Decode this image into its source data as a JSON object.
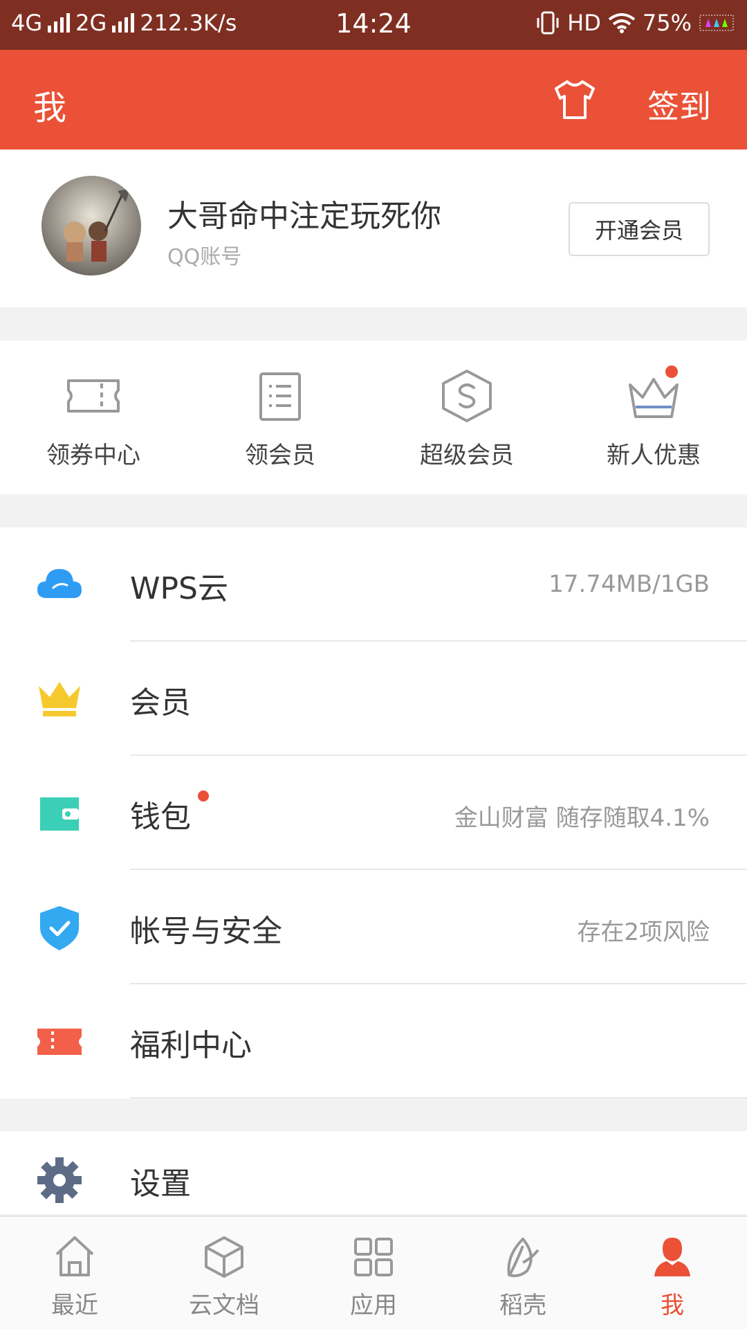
{
  "status_bar": {
    "net1": "4G",
    "net2": "2G",
    "speed": "212.3K/s",
    "time": "14:24",
    "hd": "HD",
    "battery": "75%"
  },
  "header": {
    "title": "我",
    "checkin_label": "签到",
    "shirt_icon": "tshirt-icon"
  },
  "profile": {
    "name": "大哥命中注定玩死你",
    "account_type": "QQ账号",
    "vip_button": "开通会员"
  },
  "quick_actions": [
    {
      "label": "领券中心",
      "icon": "ticket-icon"
    },
    {
      "label": "领会员",
      "icon": "list-icon"
    },
    {
      "label": "超级会员",
      "icon": "super-member-icon"
    },
    {
      "label": "新人优惠",
      "icon": "crown-icon",
      "has_dot": true
    }
  ],
  "menu": [
    {
      "label": "WPS云",
      "value": "17.74MB/1GB",
      "icon": "cloud-icon",
      "color": "#2f9cf4"
    },
    {
      "label": "会员",
      "value": "",
      "icon": "crown-icon",
      "color": "#f6c92f"
    },
    {
      "label": "钱包",
      "value": "金山财富 随存随取4.1%",
      "icon": "wallet-icon",
      "color": "#3ccfb7",
      "has_dot": true
    },
    {
      "label": "帐号与安全",
      "value": "存在2项风险",
      "icon": "shield-icon",
      "color": "#33a9f1"
    },
    {
      "label": "福利中心",
      "value": "",
      "icon": "coupon-icon",
      "color": "#f2604a"
    }
  ],
  "settings": {
    "label": "设置",
    "icon": "gear-icon",
    "color": "#5d6b86"
  },
  "bottom_nav": [
    {
      "label": "最近",
      "icon": "home-icon",
      "active": false
    },
    {
      "label": "云文档",
      "icon": "cube-icon",
      "active": false
    },
    {
      "label": "应用",
      "icon": "apps-grid-icon",
      "active": false
    },
    {
      "label": "稻壳",
      "icon": "leaf-icon",
      "active": false
    },
    {
      "label": "我",
      "icon": "person-icon",
      "active": true
    }
  ],
  "colors": {
    "accent": "#ea5137",
    "status_bar": "#7f2f22"
  }
}
